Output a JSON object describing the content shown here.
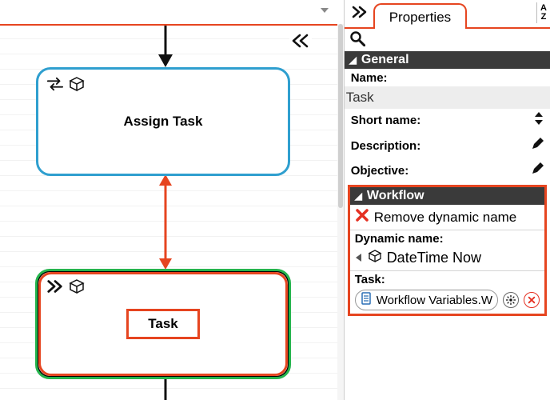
{
  "tabs": {
    "properties": "Properties",
    "corner": "A\nZ"
  },
  "toolbar_icons": {
    "search": "search-icon"
  },
  "general": {
    "title": "General",
    "name_label": "Name:",
    "name_value": "Task",
    "short_name_label": "Short name:",
    "description_label": "Description:",
    "objective_label": "Objective:"
  },
  "workflow": {
    "title": "Workflow",
    "remove_dynamic": "Remove dynamic name",
    "dynamic_name_label": "Dynamic name:",
    "dynamic_name_value": "DateTime Now",
    "task_label": "Task:",
    "task_value": "Workflow Variables.W"
  },
  "canvas": {
    "nodes": {
      "assign": {
        "label": "Assign Task"
      },
      "task": {
        "label": "Task"
      }
    }
  }
}
